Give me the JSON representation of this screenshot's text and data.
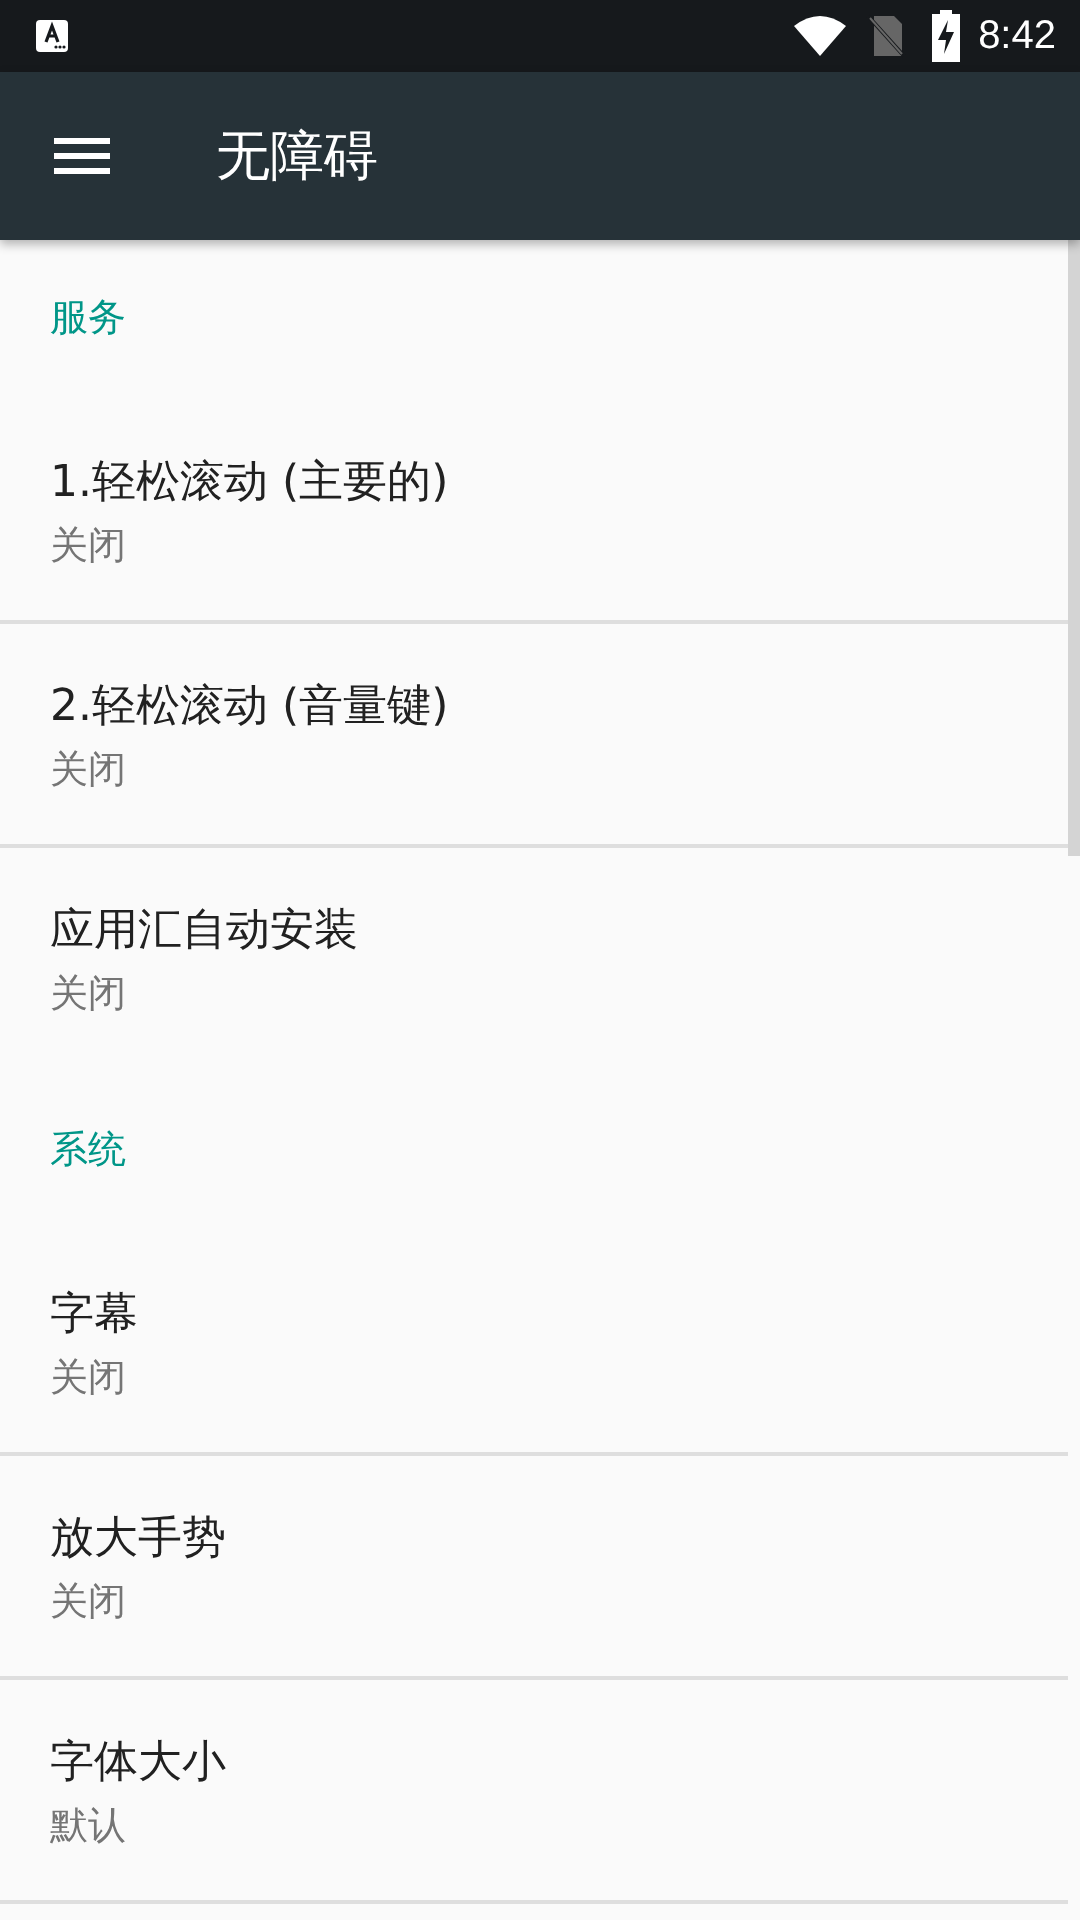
{
  "status_bar": {
    "time": "8:42"
  },
  "app_bar": {
    "title": "无障碍"
  },
  "list": [
    {
      "kind": "header",
      "title": "服务"
    },
    {
      "kind": "item",
      "title": "1.轻松滚动 (主要的)",
      "summary": "关闭"
    },
    {
      "kind": "item",
      "title": "2.轻松滚动 (音量键)",
      "summary": "关闭"
    },
    {
      "kind": "item",
      "title": "应用汇自动安装",
      "summary": "关闭"
    },
    {
      "kind": "header",
      "title": "系统"
    },
    {
      "kind": "item",
      "title": "字幕",
      "summary": "关闭"
    },
    {
      "kind": "item",
      "title": "放大手势",
      "summary": "关闭"
    },
    {
      "kind": "item",
      "title": "字体大小",
      "summary": "默认"
    }
  ]
}
